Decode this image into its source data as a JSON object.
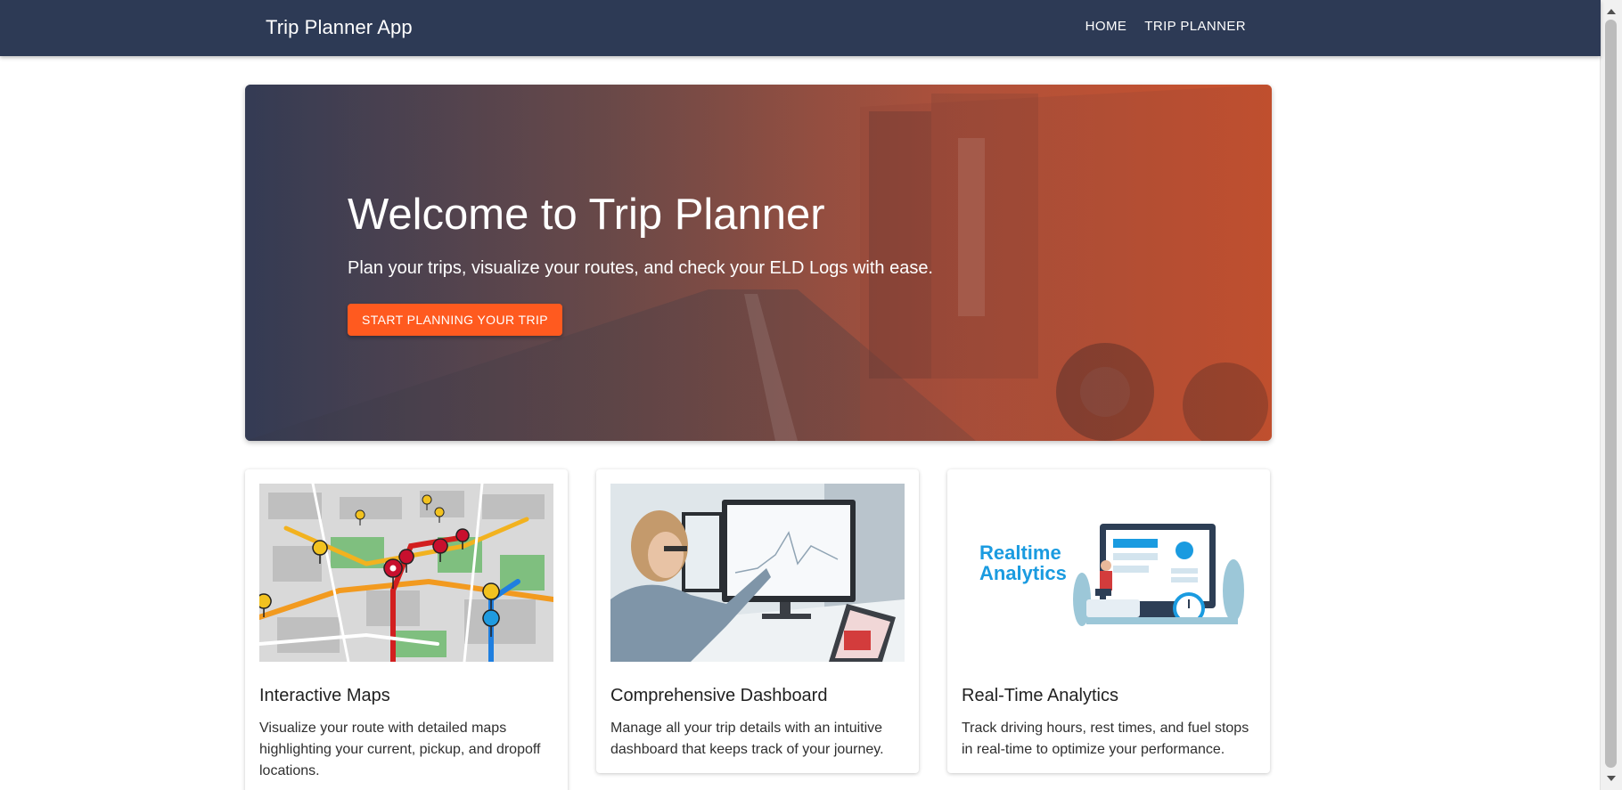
{
  "appbar": {
    "title": "Trip Planner App",
    "nav": [
      {
        "label": "HOME"
      },
      {
        "label": "TRIP PLANNER"
      }
    ]
  },
  "hero": {
    "title": "Welcome to Trip Planner",
    "subtitle": "Plan your trips, visualize your routes, and check your ELD Logs with ease.",
    "cta_label": "START PLANNING YOUR TRIP"
  },
  "features": [
    {
      "title": "Interactive Maps",
      "description": "Visualize your route with detailed maps highlighting your current, pickup, and dropoff locations."
    },
    {
      "title": "Comprehensive Dashboard",
      "description": "Manage all your trip details with an intuitive dashboard that keeps track of your journey."
    },
    {
      "title": "Real-Time Analytics",
      "description": "Track driving hours, rest times, and fuel stops in real-time to optimize your performance.",
      "image_text": [
        "Realtime",
        "Analytics"
      ]
    }
  ],
  "colors": {
    "appbar": "#2d3a55",
    "accent": "#ff5a1f",
    "analytics_blue": "#1a9be0"
  }
}
